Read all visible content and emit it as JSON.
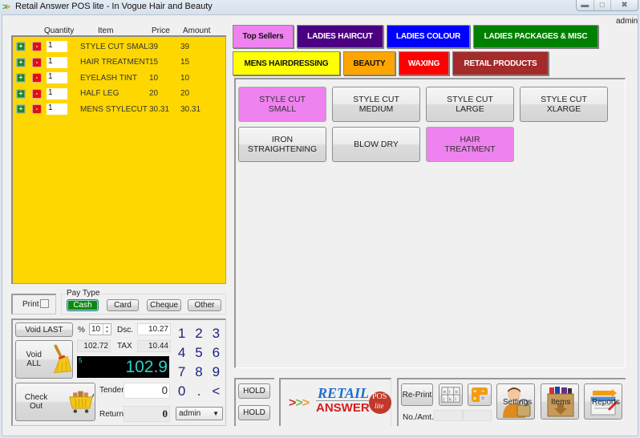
{
  "window": {
    "title": "Retail Answer POS lite - In Vogue Hair and Beauty",
    "icon": "double-chevron-icon",
    "controls": [
      "minimize",
      "maximize",
      "close"
    ],
    "user": "admin"
  },
  "order": {
    "columns": [
      "Quantity",
      "Item",
      "Price",
      "Amount"
    ],
    "rows": [
      {
        "qty": "1",
        "item": "STYLE CUT SMALL",
        "price": "39",
        "amount": "39"
      },
      {
        "qty": "1",
        "item": "HAIR TREATMENT",
        "price": "15",
        "amount": "15"
      },
      {
        "qty": "1",
        "item": "EYELASH TINT",
        "price": "10",
        "amount": "10"
      },
      {
        "qty": "1",
        "item": "HALF LEG",
        "price": "20",
        "amount": "20"
      },
      {
        "qty": "1",
        "item": "MENS STYLECUT PA",
        "price": "30.31",
        "amount": "30.31"
      }
    ],
    "plus_label": "+",
    "minus_label": "-"
  },
  "payment": {
    "print_label": "Print",
    "print_checked": false,
    "pay_type_label": "Pay Type",
    "pay_types": [
      "Cash",
      "Card",
      "Cheque",
      "Other"
    ],
    "selected": "Cash"
  },
  "totals": {
    "void_last": "Void LAST",
    "void_all": "Void ALL",
    "check_out": "Check Out",
    "percent_label": "%",
    "percent_value": "10",
    "discount_label": "Dsc.",
    "discount_value": "10.27",
    "subtotal": "102.72",
    "tax_label": "TAX",
    "tax_value": "10.44",
    "item_count": "5",
    "total": "102.9",
    "tender_label": "Tender",
    "tender_value": "0",
    "return_label": "Return",
    "return_value": "0",
    "keypad": [
      "1",
      "2",
      "3",
      "4",
      "5",
      "6",
      "7",
      "8",
      "9",
      "0",
      ".",
      "<"
    ],
    "user_select": "admin"
  },
  "categories": [
    {
      "label": "Top Sellers",
      "color": "#ee82ee",
      "text": "#111"
    },
    {
      "label": "LADIES HAIRCUT",
      "color": "#4b0082",
      "text": "#ffffff"
    },
    {
      "label": "LADIES COLOUR",
      "color": "#0000ff",
      "text": "#ffffff"
    },
    {
      "label": "LADIES PACKAGES & MISC",
      "color": "#008000",
      "text": "#ffffff"
    },
    {
      "label": "MENS HAIRDRESSING",
      "color": "#ffff00",
      "text": "#111"
    },
    {
      "label": "BEAUTY",
      "color": "#ffa500",
      "text": "#111"
    },
    {
      "label": "WAXING",
      "color": "#ff0000",
      "text": "#ffffff"
    },
    {
      "label": "RETAIL PRODUCTS",
      "color": "#a52a2a",
      "text": "#ffffff"
    }
  ],
  "items": [
    {
      "label": "STYLE CUT SMALL",
      "highlight": true
    },
    {
      "label": "STYLE CUT MEDIUM",
      "highlight": false
    },
    {
      "label": "STYLE CUT LARGE",
      "highlight": false
    },
    {
      "label": "STYLE CUT XLARGE",
      "highlight": false
    },
    {
      "label": "IRON STRAIGHTENING",
      "highlight": false
    },
    {
      "label": "BLOW DRY",
      "highlight": false
    },
    {
      "label": "HAIR TREATMENT",
      "highlight": true
    }
  ],
  "bottom": {
    "hold_1": "HOLD",
    "hold_2": "HOLD",
    "logo": {
      "arrows": ">>>",
      "word1": "RETAIL",
      "word2": "ANSWER",
      "badge1": "POS",
      "badge2": "lite"
    },
    "reprint": "Re-Print",
    "num_amt_label": "No./Amt.",
    "settings": "Settings",
    "items": "Items",
    "reports": "Reports"
  }
}
